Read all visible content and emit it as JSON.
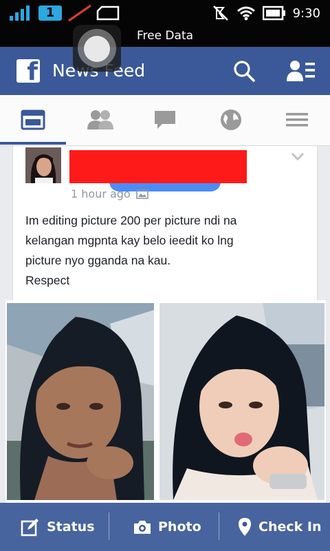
{
  "status_bar": {
    "sim_slot": "1",
    "time": "9:30",
    "icons": [
      "signal-icon",
      "no-signal-icon",
      "screen-icon",
      "mute-icon",
      "wifi-icon",
      "battery-icon"
    ]
  },
  "notice": {
    "text": "Free Data"
  },
  "header": {
    "title": "News Feed",
    "logo_icon": "facebook-logo-icon",
    "search_icon": "search-icon",
    "friend_requests_icon": "friend-requests-icon",
    "bg_color": "#3b5998"
  },
  "tabs": [
    {
      "name": "news-feed",
      "icon": "news-feed-icon",
      "active": true
    },
    {
      "name": "friends",
      "icon": "friends-icon",
      "active": false
    },
    {
      "name": "messages",
      "icon": "chat-icon",
      "active": false
    },
    {
      "name": "notifications",
      "icon": "globe-icon",
      "active": false
    },
    {
      "name": "more",
      "icon": "menu-icon",
      "active": false
    }
  ],
  "post": {
    "author_name_redacted": true,
    "timestamp": "1 hour ago",
    "text_lines": [
      "Im editing picture 200 per picture ndi na",
      "kelangan mgpnta kay belo ieedit ko lng",
      "picture nyo gganda na kau.",
      "Respect"
    ]
  },
  "bottom_bar": {
    "status_label": "Status",
    "photo_label": "Photo",
    "checkin_label": "Check In"
  }
}
